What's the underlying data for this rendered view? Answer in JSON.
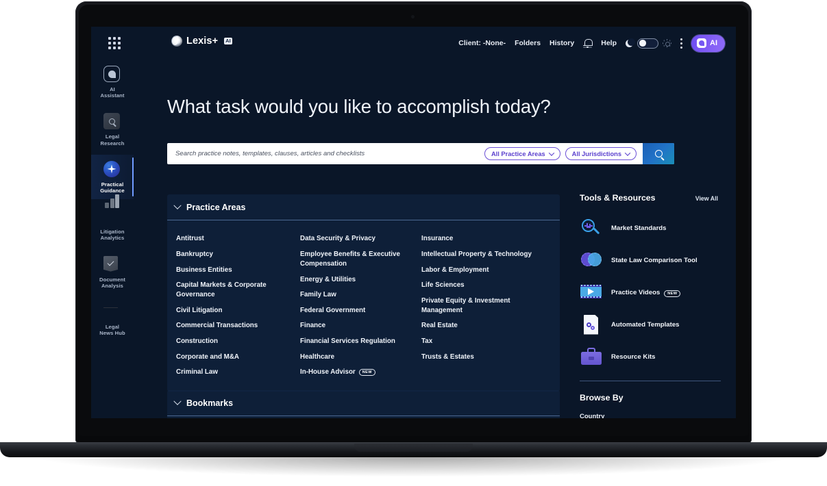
{
  "header": {
    "apps_icon": "grid-apps-icon",
    "brand": "Lexis+",
    "brand_badge": "AI",
    "nav": [
      {
        "label": "Client: -None-",
        "name": "client-selector"
      },
      {
        "label": "Folders",
        "name": "folders-link"
      },
      {
        "label": "History",
        "name": "history-link"
      }
    ],
    "bell_icon": "notification-bell-icon",
    "help_label": "Help",
    "theme": {
      "dark_icon": "moon-icon",
      "light_icon": "sun-icon",
      "state": "dark"
    },
    "more_icon": "kebab-menu-icon",
    "ai_button": {
      "label": "AI",
      "icon": "ai-sparkle-icon"
    }
  },
  "sidebar": {
    "items": [
      {
        "label": "AI\nAssistant",
        "line1": "AI",
        "line2": "Assistant",
        "icon": "ai-assistant-icon",
        "active": false
      },
      {
        "label": "Legal Research",
        "line1": "Legal",
        "line2": "Research",
        "icon": "legal-research-icon",
        "active": false
      },
      {
        "label": "Practical Guidance",
        "line1": "Practical",
        "line2": "Guidance",
        "icon": "practical-guidance-icon",
        "active": true
      },
      {
        "label": "Litigation Analytics",
        "line1": "Litigation",
        "line2": "Analytics",
        "icon": "litigation-analytics-icon",
        "active": false
      },
      {
        "label": "Document Analysis",
        "line1": "Document",
        "line2": "Analysis",
        "icon": "document-analysis-icon",
        "active": false
      },
      {
        "label": "Legal News Hub",
        "line1": "Legal",
        "line2": "News Hub",
        "icon": "legal-news-hub-icon",
        "active": false
      }
    ]
  },
  "main": {
    "hero_title": "What task would you like to accomplish today?",
    "search": {
      "placeholder": "Search practice notes, templates, clauses, articles and checklists",
      "value": "",
      "practice_areas_filter": "All Practice Areas",
      "jurisdictions_filter": "All Jurisdictions",
      "search_icon": "search-magnifier-icon"
    },
    "practice_areas": {
      "title": "Practice Areas",
      "expanded": true,
      "columns": [
        [
          {
            "label": "Antitrust"
          },
          {
            "label": "Bankruptcy"
          },
          {
            "label": "Business Entities"
          },
          {
            "label": "Capital Markets & Corporate Governance"
          },
          {
            "label": "Civil Litigation"
          },
          {
            "label": "Commercial Transactions"
          },
          {
            "label": "Construction"
          },
          {
            "label": "Corporate and M&A"
          },
          {
            "label": "Criminal Law"
          }
        ],
        [
          {
            "label": "Data Security & Privacy"
          },
          {
            "label": "Employee Benefits & Executive Compensation"
          },
          {
            "label": "Energy & Utilities"
          },
          {
            "label": "Family Law"
          },
          {
            "label": "Federal Government"
          },
          {
            "label": "Finance"
          },
          {
            "label": "Financial Services Regulation"
          },
          {
            "label": "Healthcare"
          },
          {
            "label": "In-House Advisor",
            "badge": "NEW"
          }
        ],
        [
          {
            "label": "Insurance"
          },
          {
            "label": "Intellectual Property & Technology"
          },
          {
            "label": "Labor & Employment"
          },
          {
            "label": "Life Sciences"
          },
          {
            "label": "Private Equity & Investment Management"
          },
          {
            "label": "Real Estate"
          },
          {
            "label": "Tax"
          },
          {
            "label": "Trusts & Estates"
          }
        ]
      ]
    },
    "bookmarks": {
      "title": "Bookmarks",
      "expanded": true
    }
  },
  "tools": {
    "title": "Tools & Resources",
    "view_all": "View All",
    "items": [
      {
        "label": "Market Standards",
        "icon": "market-standards-icon"
      },
      {
        "label": "State Law Comparison Tool",
        "icon": "state-law-comparison-icon"
      },
      {
        "label": "Practice Videos",
        "badge": "NEW",
        "icon": "practice-videos-icon"
      },
      {
        "label": "Automated Templates",
        "icon": "automated-templates-icon"
      },
      {
        "label": "Resource Kits",
        "icon": "resource-kits-icon"
      }
    ]
  },
  "browse": {
    "title": "Browse By",
    "items": [
      {
        "label": "Country"
      }
    ]
  },
  "colors": {
    "screen_bg": "#0a1628",
    "panel_bg": "#122848",
    "accent_purple": "#6b4fd6",
    "accent_blue": "#2172c7",
    "active_rail": "#6f9bff"
  }
}
